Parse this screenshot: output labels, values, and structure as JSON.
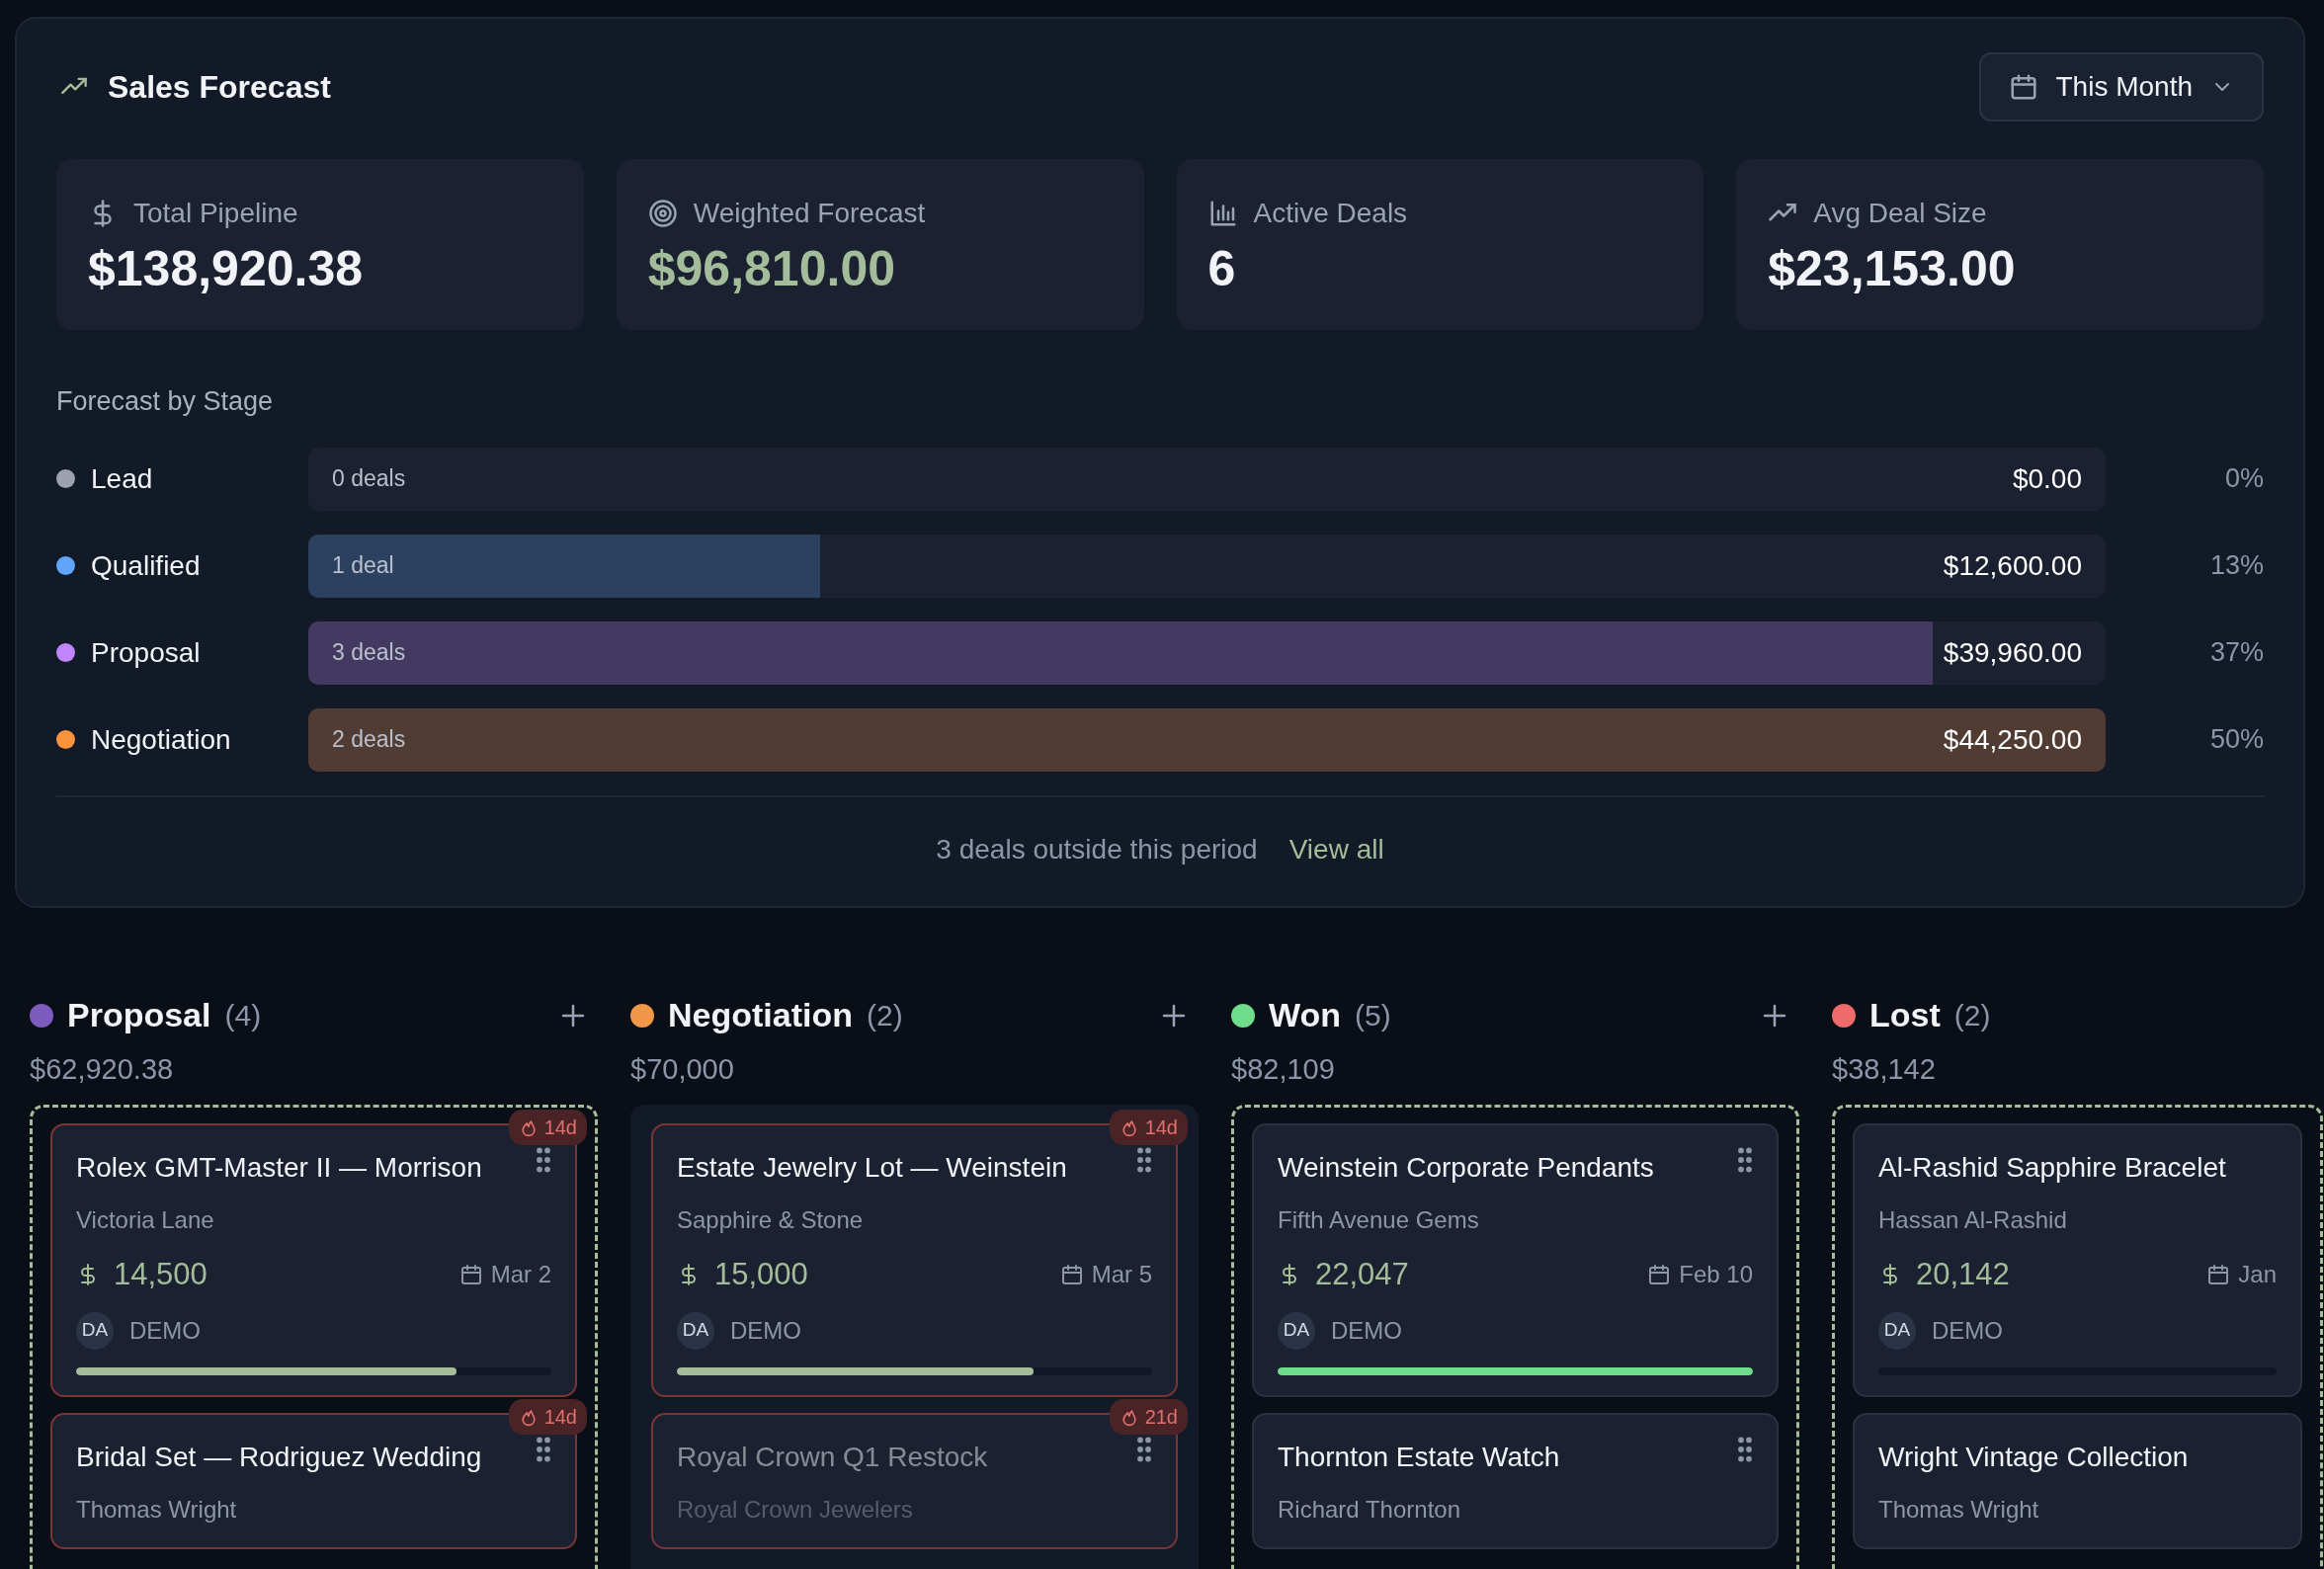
{
  "forecast": {
    "title": "Sales Forecast",
    "period": "This Month",
    "stats": [
      {
        "kind": "dollar",
        "label": "Total Pipeline",
        "value": "$138,920.38",
        "accent": false
      },
      {
        "kind": "target",
        "label": "Weighted Forecast",
        "value": "$96,810.00",
        "accent": true
      },
      {
        "kind": "bars",
        "label": "Active Deals",
        "value": "6",
        "accent": false
      },
      {
        "kind": "trend",
        "label": "Avg Deal Size",
        "value": "$23,153.00",
        "accent": false
      }
    ],
    "stages_title": "Forecast by Stage",
    "stages": [
      {
        "name": "Lead",
        "color": "#9ca3af",
        "deals": "0 deals",
        "amount": "$0.00",
        "percent": "0%",
        "level": 0
      },
      {
        "name": "Qualified",
        "color": "#60a5fa",
        "deals": "1 deal",
        "amount": "$12,600.00",
        "percent": "13%",
        "level": 0.285
      },
      {
        "name": "Proposal",
        "color": "#c084fc",
        "deals": "3 deals",
        "amount": "$39,960.00",
        "percent": "37%",
        "level": 0.904
      },
      {
        "name": "Negotiation",
        "color": "#fb923c",
        "deals": "2 deals",
        "amount": "$44,250.00",
        "percent": "50%",
        "level": 1
      }
    ],
    "footer": {
      "text": "3 deals outside this period",
      "link": "View all"
    }
  },
  "board": {
    "columns": [
      {
        "name": "Proposal",
        "count": "(4)",
        "total": "$62,920.38",
        "color": "#7c5cbf",
        "kind": "open",
        "drop_target": true,
        "can_add": true,
        "cards": [
          {
            "title": "Rolex GMT-Master II — Morrison",
            "client": "Victoria Lane",
            "amount": "14,500",
            "date": "Mar 2",
            "owner": "DA",
            "owner_name": "DEMO",
            "level": 0.8,
            "stale": "14d",
            "faded": false
          },
          {
            "title": "Bridal Set — Rodriguez Wedding",
            "client": "Thomas Wright",
            "stale": "14d",
            "faded": false
          }
        ]
      },
      {
        "name": "Negotiation",
        "count": "(2)",
        "total": "$70,000",
        "color": "#f0974a",
        "kind": "open",
        "drop_target": false,
        "can_add": true,
        "cards": [
          {
            "title": "Estate Jewelry Lot — Weinstein",
            "client": "Sapphire & Stone",
            "amount": "15,000",
            "date": "Mar 5",
            "owner": "DA",
            "owner_name": "DEMO",
            "level": 0.75,
            "stale": "14d",
            "faded": false
          },
          {
            "title": "Royal Crown Q1 Restock",
            "client": "Royal Crown Jewelers",
            "stale": "21d",
            "faded": true
          }
        ]
      },
      {
        "name": "Won",
        "count": "(5)",
        "total": "$82,109",
        "color": "#6fdc8c",
        "kind": "won",
        "drop_target": true,
        "can_add": true,
        "cards": [
          {
            "title": "Weinstein Corporate Pendants",
            "client": "Fifth Avenue Gems",
            "amount": "22,047",
            "date": "Feb 10",
            "owner": "DA",
            "owner_name": "DEMO",
            "level": 1,
            "faded": false
          },
          {
            "title": "Thornton Estate Watch",
            "client": "Richard Thornton",
            "faded": false
          }
        ]
      },
      {
        "name": "Lost",
        "count": "(2)",
        "total": "$38,142",
        "color": "#ee6b6b",
        "kind": "lost",
        "drop_target": true,
        "can_add": false,
        "cards": [
          {
            "title": "Al-Rashid Sapphire Bracelet",
            "client": "Hassan Al-Rashid",
            "amount": "20,142",
            "date": "Jan",
            "owner": "DA",
            "owner_name": "DEMO",
            "level": 0,
            "faded": false
          },
          {
            "title": "Wright Vintage Collection",
            "client": "Thomas Wright",
            "faded": false
          }
        ]
      }
    ]
  }
}
